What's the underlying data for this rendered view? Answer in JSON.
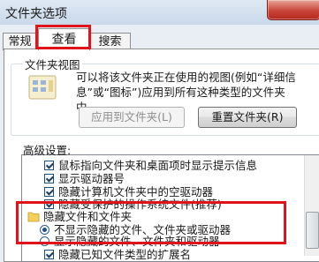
{
  "window": {
    "title": "文件夹选项"
  },
  "tabs": [
    {
      "label": "常规"
    },
    {
      "label": "查看"
    },
    {
      "label": "搜索"
    }
  ],
  "folder_views": {
    "title": "文件夹视图",
    "description_line1": "可以将该文件夹正在使用的视图(例如“详细信",
    "description_line2": "息”或“图标”)应用到所有这种类型的文件夹",
    "description_line3": "中。",
    "apply_button": "应用到文件夹(L)",
    "reset_button": "重置文件夹(R)"
  },
  "advanced": {
    "label": "高级设置:",
    "items": [
      {
        "text": "鼠标指向文件夹和桌面项时显示提示信息",
        "checked": true
      },
      {
        "text": "显示驱动器号",
        "checked": true
      },
      {
        "text": "隐藏计算机文件夹中的空驱动器",
        "checked": true
      },
      {
        "text": "隐藏受保护的操作系统文件(推荐)",
        "checked": true
      }
    ],
    "hidden_files": {
      "folder_label": "隐藏文件和文件夹",
      "option_hide": "不显示隐藏的文件、文件夹或驱动器",
      "option_show": "显示隐藏的文件、文件夹和驱动器",
      "selected": "option_hide"
    },
    "last_item": {
      "text": "隐藏已知文件类型的扩展名",
      "checked": false
    }
  },
  "colors": {
    "highlight": "#e0131b"
  }
}
